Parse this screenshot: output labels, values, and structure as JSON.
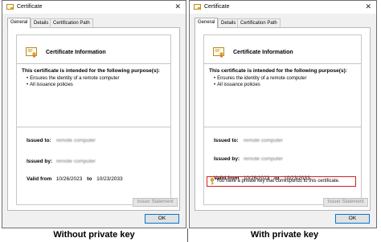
{
  "dialogs": [
    {
      "title": "Certificate",
      "tabs": [
        "General",
        "Details",
        "Certification Path"
      ],
      "info_title": "Certificate Information",
      "purpose_heading": "This certificate is intended for the following purpose(s):",
      "purposes": [
        "Ensures the identity of a remote computer",
        "All issuance policies"
      ],
      "issued_to_label": "Issued to:",
      "issued_to_value": "remote computer",
      "issued_by_label": "Issued by:",
      "issued_by_value": "remote computer",
      "valid_from_label": "Valid from",
      "valid_from": "10/26/2023",
      "valid_to_label": "to",
      "valid_to": "10/23/2033",
      "issuer_statement": "Issuer Statement",
      "ok": "OK",
      "close_icon": "close-icon"
    },
    {
      "title": "Certificate",
      "tabs": [
        "General",
        "Details",
        "Certification Path"
      ],
      "info_title": "Certificate Information",
      "purpose_heading": "This certificate is intended for the following purpose(s):",
      "purposes": [
        "Ensures the identity of a remote computer",
        "All issuance policies"
      ],
      "issued_to_label": "Issued to:",
      "issued_to_value": "remote computer",
      "issued_by_label": "Issued by:",
      "issued_by_value": "remote computer",
      "valid_from_label": "Valid from",
      "valid_from": "10/26/2023",
      "valid_to_label": "to",
      "valid_to": "10/23/2033",
      "private_key_note": "You have a private key that corresponds to this certificate.",
      "issuer_statement": "Issuer Statement",
      "ok": "OK",
      "close_icon": "close-icon"
    }
  ],
  "captions": [
    "Without private key",
    "With private key"
  ],
  "colors": {
    "highlight_border": "#d22020",
    "ok_border": "#0078d7"
  }
}
